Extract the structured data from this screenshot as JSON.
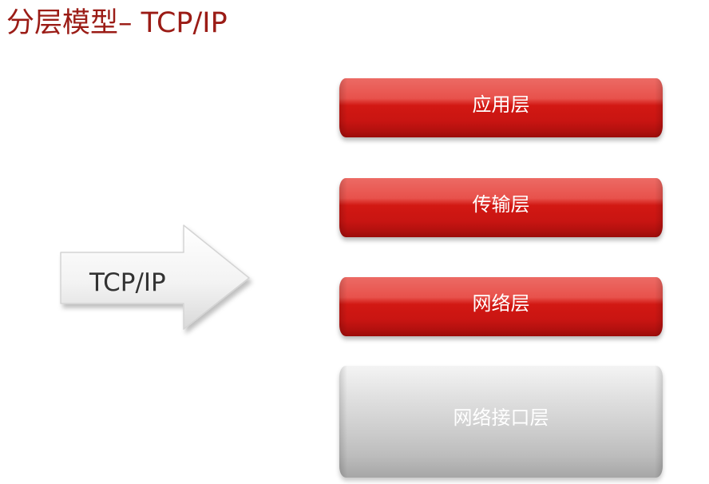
{
  "title": "分层模型– TCP/IP",
  "arrow": {
    "label": "TCP/IP",
    "icon": "right-arrow-icon"
  },
  "layers": [
    {
      "label": "应用层",
      "style": "red"
    },
    {
      "label": "传输层",
      "style": "red"
    },
    {
      "label": "网络层",
      "style": "red"
    },
    {
      "label": "网络接口层",
      "style": "gray"
    }
  ],
  "colors": {
    "title": "#9b1c16",
    "layer_red": "#c91512",
    "layer_gray": "#cfcfcf",
    "arrow_fill": "#f2f2f2"
  }
}
